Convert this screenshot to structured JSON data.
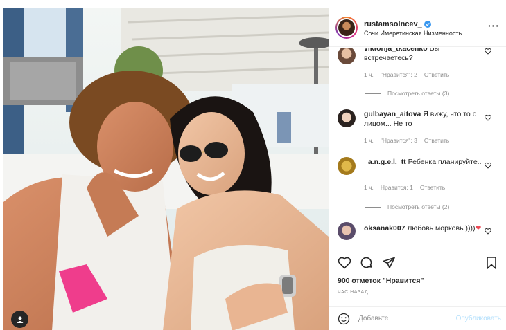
{
  "post": {
    "username": "rustamsolncev_",
    "location": "Сочи Имеретинская Низменность",
    "more_icon": "more-horizontal-icon"
  },
  "comments": [
    {
      "user": "viktorija_tkacenko",
      "text": "Вы встречаетесь?",
      "time": "1 ч.",
      "likes": "\"Нравится\": 2",
      "reply": "Ответить",
      "replies": "Посмотреть ответы (3)"
    },
    {
      "user": "gulbayan_aitova",
      "text": "Я вижу, что то с лицом... Не то",
      "time": "1 ч.",
      "likes": "\"Нравится\": 3",
      "reply": "Ответить",
      "replies": ""
    },
    {
      "user": "_a.n.g.e.l._tt",
      "text": "Ребенка планируйте..",
      "time": "1 ч.",
      "likes": "Нравится: 1",
      "reply": "Ответить",
      "replies": "Посмотреть ответы (2)"
    },
    {
      "user": "oksanak007",
      "text": "Любовь морковь ))))",
      "time": "",
      "likes": "",
      "reply": "",
      "replies": ""
    }
  ],
  "actions": {
    "likes_text": "900 отметок \"Нравится\"",
    "time_ago": "ЧАС НАЗАД",
    "comment_placeholder": "Добавьте",
    "publish_label": "Опубликовать"
  },
  "colors": {
    "verified": "#3897f0",
    "publish": "#b2dffc",
    "meta": "#8e8e8e",
    "heart": "#ed4956"
  }
}
